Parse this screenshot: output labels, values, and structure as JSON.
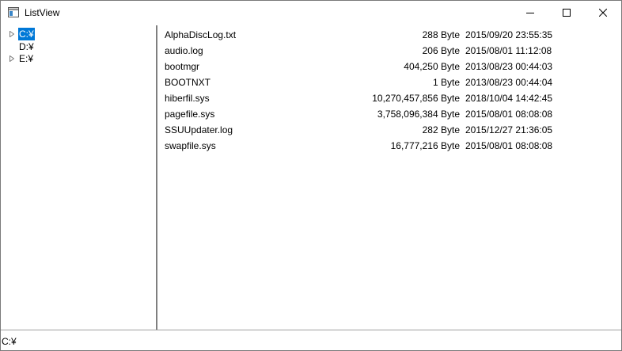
{
  "window": {
    "title": "ListView"
  },
  "titlebar": {
    "icon": "window-app-icon",
    "buttons": [
      "minimize-icon",
      "maximize-icon",
      "close-icon"
    ]
  },
  "tree": {
    "items": [
      {
        "label": "C:¥",
        "selected": true,
        "expandable": true
      },
      {
        "label": "D:¥",
        "selected": false,
        "expandable": false
      },
      {
        "label": "E:¥",
        "selected": false,
        "expandable": true
      }
    ]
  },
  "files": [
    {
      "name": "AlphaDiscLog.txt",
      "size": "288 Byte",
      "date": "2015/09/20 23:55:35"
    },
    {
      "name": "audio.log",
      "size": "206 Byte",
      "date": "2015/08/01 11:12:08"
    },
    {
      "name": "bootmgr",
      "size": "404,250 Byte",
      "date": "2013/08/23 00:44:03"
    },
    {
      "name": "BOOTNXT",
      "size": "1 Byte",
      "date": "2013/08/23 00:44:04"
    },
    {
      "name": "hiberfil.sys",
      "size": "10,270,457,856 Byte",
      "date": "2018/10/04 14:42:45"
    },
    {
      "name": "pagefile.sys",
      "size": "3,758,096,384 Byte",
      "date": "2015/08/01 08:08:08"
    },
    {
      "name": "SSUUpdater.log",
      "size": "282 Byte",
      "date": "2015/12/27 21:36:05"
    },
    {
      "name": "swapfile.sys",
      "size": "16,777,216 Byte",
      "date": "2015/08/01 08:08:08"
    }
  ],
  "statusbar": {
    "text": "C:¥"
  },
  "colors": {
    "selection": "#0078d7",
    "splitter": "#7f7f7f",
    "border": "#7a7a7a"
  }
}
